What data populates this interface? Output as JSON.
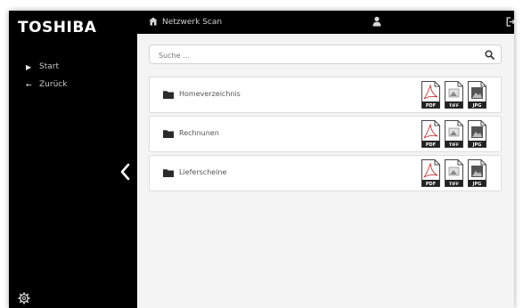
{
  "brand": {
    "logo_text": "TOSHIBA"
  },
  "header": {
    "title": "Netzwerk Scan"
  },
  "sidebar": {
    "items": [
      {
        "label": "Start",
        "icon": "play-icon"
      },
      {
        "label": "Zurück",
        "icon": "arrow-left-icon"
      }
    ]
  },
  "search": {
    "placeholder": "Suche ..."
  },
  "folders": [
    {
      "label": "Homeverzeichnis"
    },
    {
      "label": "Rechnunen"
    },
    {
      "label": "Lieferscheine"
    }
  ],
  "file_types": [
    "PDF",
    "TIFF",
    "JPG"
  ],
  "colors": {
    "sidebar": "#000000",
    "content": "#f4f4f4",
    "pdf_accent": "#cc3333"
  }
}
